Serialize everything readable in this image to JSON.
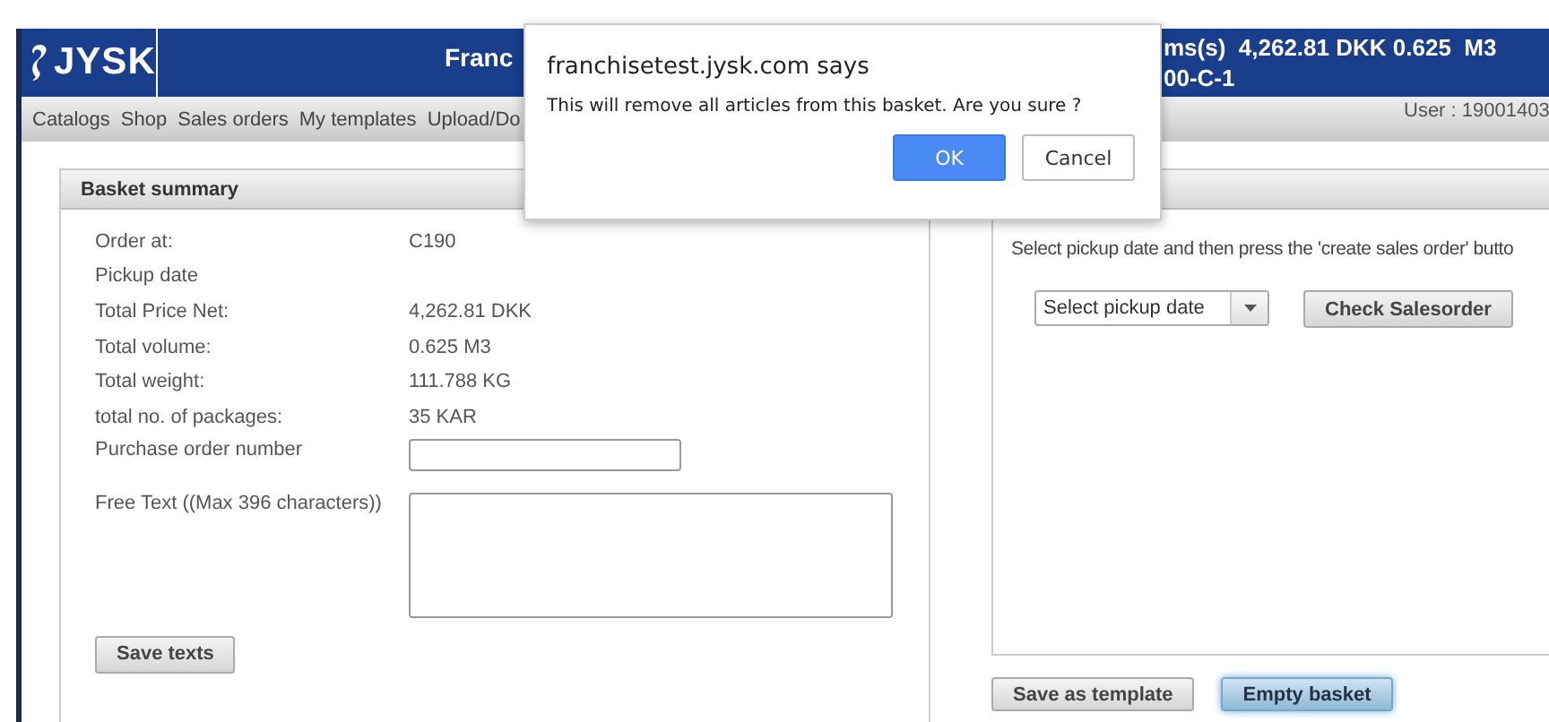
{
  "header": {
    "logo_text": "JYSK",
    "title_fragment": "Franc",
    "summary_line_1": "ms(s)  4,262.81 DKK 0.625  M3",
    "summary_line_2": "00-C-1"
  },
  "nav": {
    "items": [
      "Catalogs",
      "Shop",
      "Sales orders",
      "My templates",
      "Upload/Do"
    ],
    "user": "User : 19001403"
  },
  "basket_summary": {
    "title": "Basket summary",
    "rows": [
      {
        "label": "Order at:",
        "value": "C190"
      },
      {
        "label": "Pickup date",
        "value": ""
      },
      {
        "label": "Total Price Net:",
        "value": "4,262.81 DKK"
      },
      {
        "label": "Total volume:",
        "value": "0.625 M3"
      },
      {
        "label": "Total weight:",
        "value": "111.788 KG"
      },
      {
        "label": "total no. of packages:",
        "value": "35 KAR"
      }
    ],
    "purchase_order_label": "Purchase order number",
    "free_text_label": "Free Text ((Max 396 characters))",
    "save_button": "Save texts"
  },
  "sales_order": {
    "instruction": "Select pickup date and then press the 'create sales order' butto",
    "pickup_select": "Select pickup date",
    "check_button": "Check Salesorder"
  },
  "bottom_buttons": [
    {
      "label": "Save as template",
      "focused": false
    },
    {
      "label": "Empty basket",
      "focused": true
    }
  ],
  "dialog": {
    "title": "franchisetest.jysk.com says",
    "message": "This will remove all articles from this basket. Are you sure ?",
    "buttons": [
      {
        "label": "OK",
        "default": true
      },
      {
        "label": "Cancel",
        "default": false
      }
    ]
  }
}
